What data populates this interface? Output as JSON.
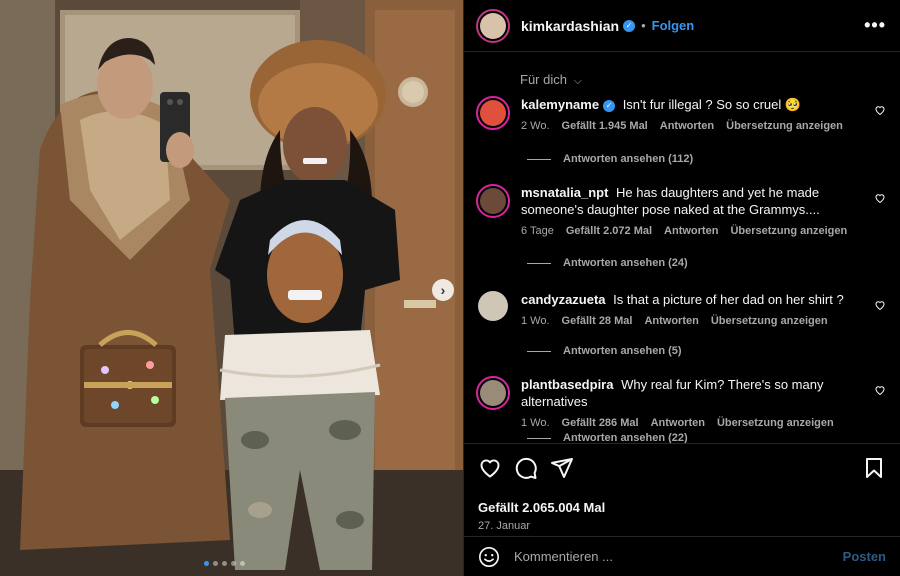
{
  "post": {
    "author": "kimkardashian",
    "follow_label": "Folgen",
    "separator": "•",
    "more": "•••",
    "next_arrow": "›",
    "carousel_dots": 5,
    "carousel_active": 0
  },
  "comments_section": {
    "filter_label": "Für dich",
    "filter_chevron": "⌵",
    "items": [
      {
        "username": "kalemyname",
        "verified": true,
        "text": "Isn't fur illegal ? So so cruel 🥺",
        "time": "2 Wo.",
        "likes": "Gefällt 1.945 Mal",
        "reply": "Antworten",
        "translate": "Übersetzung anzeigen",
        "view_replies": "Antworten ansehen (112)"
      },
      {
        "username": "msnatalia_npt",
        "verified": false,
        "text": "He has daughters and yet he made someone's daughter pose naked at the Grammys....",
        "time": "6 Tage",
        "likes": "Gefällt 2.072 Mal",
        "reply": "Antworten",
        "translate": "Übersetzung anzeigen",
        "view_replies": "Antworten ansehen (24)"
      },
      {
        "username": "candyzazueta",
        "verified": false,
        "text": "Is that a picture of her dad on her shirt ?",
        "time": "1 Wo.",
        "likes": "Gefällt 28 Mal",
        "reply": "Antworten",
        "translate": "Übersetzung anzeigen",
        "view_replies": "Antworten ansehen (5)"
      },
      {
        "username": "plantbasedpira",
        "verified": false,
        "text": "Why real fur Kim? There's so many alternatives",
        "time": "1 Wo.",
        "likes": "Gefällt 286 Mal",
        "reply": "Antworten",
        "translate": "Übersetzung anzeigen",
        "view_replies": "Antworten ansehen (22)"
      }
    ]
  },
  "actions": {
    "like_icon": "heart-icon",
    "comment_icon": "comment-icon",
    "share_icon": "share-icon",
    "save_icon": "bookmark-icon",
    "likes_total": "Gefällt 2.065.004 Mal",
    "date": "27. Januar"
  },
  "composer": {
    "placeholder": "Kommentieren ...",
    "post_label": "Posten"
  },
  "colors": {
    "accent": "#3797f0",
    "background": "#000000",
    "muted": "#a8a8a8",
    "post_disabled": "#2c5b87"
  }
}
